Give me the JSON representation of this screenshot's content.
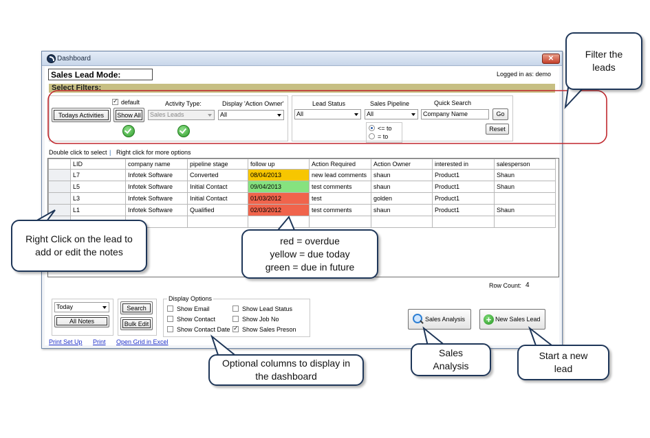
{
  "window": {
    "title": "Dashboard",
    "close_glyph": "✕",
    "close_icon": "close-icon"
  },
  "header": {
    "mode_label": "Sales Lead Mode:",
    "logged_in": "Logged in as: demo"
  },
  "filters": {
    "section_title": "Select Filters:",
    "todays_activities": "Todays Activities",
    "show_all": "Show All",
    "default_label": "default",
    "default_checked": true,
    "activity_type_label": "Activity Type:",
    "activity_type_value": "Sales Leads",
    "action_owner_label": "Display 'Action Owner'",
    "action_owner_value": "All",
    "lead_status_label": "Lead Status",
    "lead_status_value": "All",
    "sales_pipeline_label": "Sales Pipeline",
    "sales_pipeline_value": "All",
    "quick_search_label": "Quick Search",
    "quick_search_value": "Company Name",
    "go": "Go",
    "reset": "Reset",
    "radio_lte": "<= to",
    "radio_eq": "= to"
  },
  "hint": {
    "left": "Double click to select",
    "separator": "|",
    "right": "Right click for more options"
  },
  "grid": {
    "columns": [
      "LID",
      "company name",
      "pipeline stage",
      "follow up",
      "Action Required",
      "Action Owner",
      "interested in",
      "salesperson"
    ],
    "rows": [
      [
        "L7",
        "Infotek Software",
        "Converted",
        "08/04/2013",
        "new lead comments",
        "shaun",
        "Product1",
        "Shaun"
      ],
      [
        "L5",
        "Infotek Software",
        "Initial Contact",
        "09/04/2013",
        "test comments",
        "shaun",
        "Product1",
        "Shaun"
      ],
      [
        "L3",
        "Infotek Software",
        "Initial Contact",
        "01/03/2012",
        "test",
        "golden",
        "Product1",
        ""
      ],
      [
        "L1",
        "Infotek Software",
        "Qualified",
        "02/03/2012",
        "test comments",
        "shaun",
        "Product1",
        "Shaun"
      ]
    ],
    "followup_colors": [
      "#f7c600",
      "#86e27f",
      "#f0644c",
      "#f0644c"
    ]
  },
  "row_count": {
    "label": "Row Count:",
    "value": "4"
  },
  "bottom": {
    "period_value": "Today",
    "all_notes": "All Notes",
    "search": "Search",
    "bulk_edit": "Bulk Edit",
    "display_options_title": "Display Options",
    "options": [
      {
        "label": "Show Email",
        "checked": false
      },
      {
        "label": "Show Contact",
        "checked": false
      },
      {
        "label": "Show Contact Date",
        "checked": false
      },
      {
        "label": "Show Lead Status",
        "checked": false
      },
      {
        "label": "Show Job No",
        "checked": false
      },
      {
        "label": "Show Sales Preson",
        "checked": true
      }
    ],
    "sales_analysis": "Sales Analysis",
    "new_sales_lead": "New Sales Lead",
    "print_setup": "Print Set Up",
    "print": "Print",
    "open_grid": "Open Grid in Excel"
  },
  "callouts": {
    "filter": "Filter the leads",
    "right_click": "Right Click on the lead to add or edit the notes",
    "legend_line1": "red = overdue",
    "legend_line2": "yellow = due today",
    "legend_line3": "green = due in future",
    "optional_columns": "Optional columns to display in the dashboard",
    "sales_analysis": "Sales Analysis",
    "start_new": "Start a new lead"
  },
  "colors": {
    "accent_red_outline": "#c0272d",
    "callout_border": "#1e3658",
    "filter_bar": "#c7bf83",
    "link": "#1c2ec8"
  }
}
